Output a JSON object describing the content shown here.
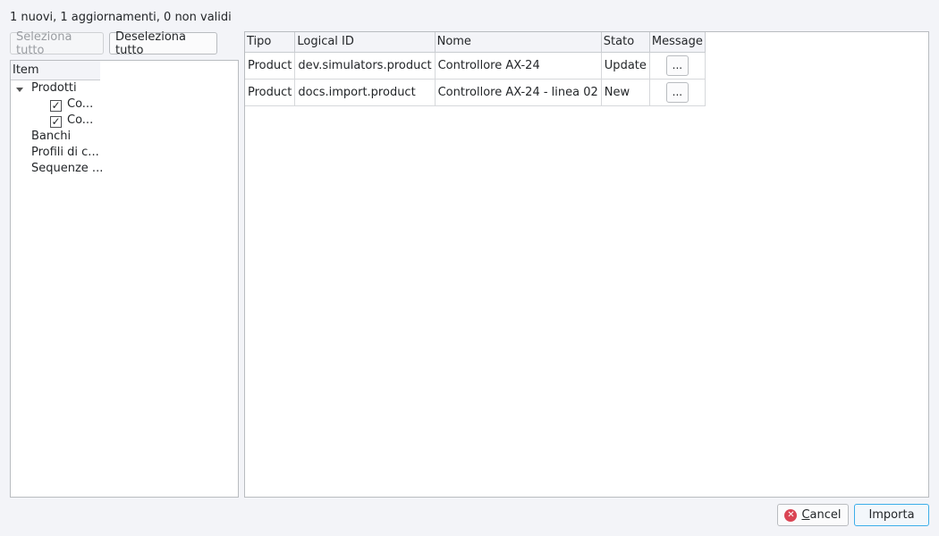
{
  "summary": "1 nuovi, 1 aggiornamenti, 0 non validi",
  "toolbar": {
    "select_all": "Seleziona tutto",
    "deselect_all": "Deseleziona tutto"
  },
  "tree": {
    "header": "Item",
    "root": "Prodotti",
    "children": [
      {
        "label": "Co...",
        "checked": true
      },
      {
        "label": "Co...",
        "checked": true
      }
    ],
    "others": [
      "Banchi",
      "Profili di c...",
      "Sequenze ..."
    ]
  },
  "table": {
    "columns": [
      "Tipo",
      "Logical ID",
      "Nome",
      "Stato",
      "Message"
    ],
    "rows": [
      {
        "tipo": "Product",
        "logical_id": "dev.simulators.product",
        "nome": "Controllore AX-24",
        "stato": "Update",
        "message": "..."
      },
      {
        "tipo": "Product",
        "logical_id": "docs.import.product",
        "nome": "Controllore AX-24 - linea 02",
        "stato": "New",
        "message": "..."
      }
    ]
  },
  "footer": {
    "cancel_label": "Cancel",
    "cancel_mnemonic": "C",
    "cancel_rest": "ancel",
    "import_label": "Importa",
    "cancel_icon": "x-circle-icon"
  },
  "colors": {
    "accent": "#3daee9",
    "cancel_icon": "#da4453"
  }
}
